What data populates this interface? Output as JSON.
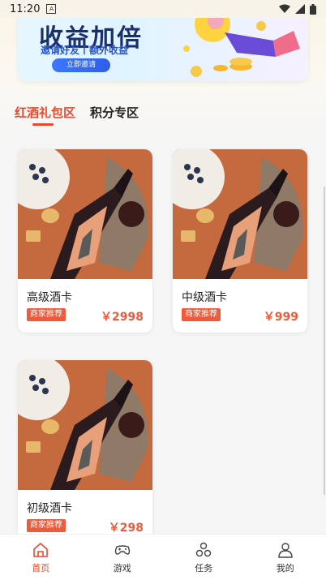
{
  "status": {
    "time": "11:20",
    "notif": "A"
  },
  "banner": {
    "title": "收益加倍",
    "subtitle": "邀请好友丨额外收益",
    "button": "立即邀请"
  },
  "tabs": [
    {
      "label": "红酒礼包区",
      "active": true
    },
    {
      "label": "积分专区",
      "active": false
    }
  ],
  "products": [
    {
      "name": "高级酒卡",
      "tag": "商家推荐",
      "price": "￥2998"
    },
    {
      "name": "中级酒卡",
      "tag": "商家推荐",
      "price": "￥999"
    },
    {
      "name": "初级酒卡",
      "tag": "商家推荐",
      "price": "￥298"
    }
  ],
  "nav": [
    {
      "label": "首页",
      "icon": "home-icon",
      "active": true
    },
    {
      "label": "游戏",
      "icon": "gamepad-icon",
      "active": false
    },
    {
      "label": "任务",
      "icon": "task-icon",
      "active": false
    },
    {
      "label": "我的",
      "icon": "user-icon",
      "active": false
    }
  ],
  "colors": {
    "accent": "#e84a2e",
    "price": "#f05a37",
    "tag": "#ef5a3b"
  }
}
